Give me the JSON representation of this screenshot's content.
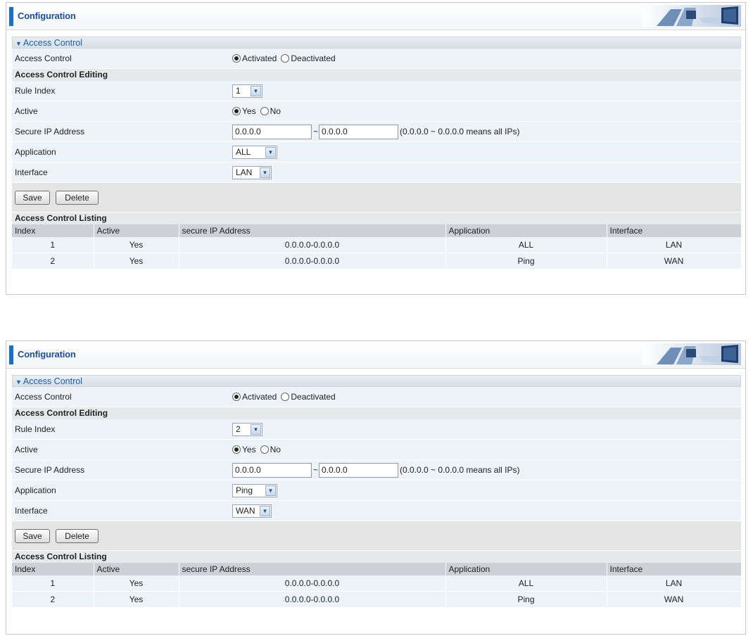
{
  "panels": [
    {
      "header": {
        "title": "Configuration"
      },
      "section_title": "Access Control",
      "access_control": {
        "label": "Access Control",
        "options": [
          "Activated",
          "Deactivated"
        ],
        "selected": 0
      },
      "editing_title": "Access Control Editing",
      "rule_index": {
        "label": "Rule Index",
        "value": "1"
      },
      "active": {
        "label": "Active",
        "options": [
          "Yes",
          "No"
        ],
        "selected": 0
      },
      "secure_ip": {
        "label": "Secure IP Address",
        "from": "0.0.0.0",
        "sep": "~",
        "to": "0.0.0.0",
        "hint": "(0.0.0.0 ~ 0.0.0.0 means all IPs)"
      },
      "application": {
        "label": "Application",
        "value": "ALL"
      },
      "interface": {
        "label": "Interface",
        "value": "LAN"
      },
      "buttons": {
        "save": "Save",
        "delete": "Delete"
      },
      "listing": {
        "title": "Access Control Listing",
        "columns": [
          "Index",
          "Active",
          "secure IP Address",
          "Application",
          "Interface"
        ],
        "rows": [
          [
            "1",
            "Yes",
            "0.0.0.0-0.0.0.0",
            "ALL",
            "LAN"
          ],
          [
            "2",
            "Yes",
            "0.0.0.0-0.0.0.0",
            "Ping",
            "WAN"
          ]
        ]
      }
    },
    {
      "header": {
        "title": "Configuration"
      },
      "section_title": "Access Control",
      "access_control": {
        "label": "Access Control",
        "options": [
          "Activated",
          "Deactivated"
        ],
        "selected": 0
      },
      "editing_title": "Access Control Editing",
      "rule_index": {
        "label": "Rule Index",
        "value": "2"
      },
      "active": {
        "label": "Active",
        "options": [
          "Yes",
          "No"
        ],
        "selected": 0
      },
      "secure_ip": {
        "label": "Secure IP Address",
        "from": "0.0.0.0",
        "sep": "~",
        "to": "0.0.0.0",
        "hint": "(0.0.0.0 ~ 0.0.0.0 means all IPs)"
      },
      "application": {
        "label": "Application",
        "value": "Ping"
      },
      "interface": {
        "label": "Interface",
        "value": "WAN"
      },
      "buttons": {
        "save": "Save",
        "delete": "Delete"
      },
      "listing": {
        "title": "Access Control Listing",
        "columns": [
          "Index",
          "Active",
          "secure IP Address",
          "Application",
          "Interface"
        ],
        "rows": [
          [
            "1",
            "Yes",
            "0.0.0.0-0.0.0.0",
            "ALL",
            "LAN"
          ],
          [
            "2",
            "Yes",
            "0.0.0.0-0.0.0.0",
            "Ping",
            "WAN"
          ]
        ]
      }
    }
  ],
  "colors": {
    "accent": "#1a6fc0",
    "row_bg": "#edf3f9",
    "header_gray": "#cdd0d4"
  },
  "icons": {
    "section_toggle": "triangle-down-icon",
    "select_arrow": "chevron-down-icon",
    "banner": "network-devices-banner"
  }
}
